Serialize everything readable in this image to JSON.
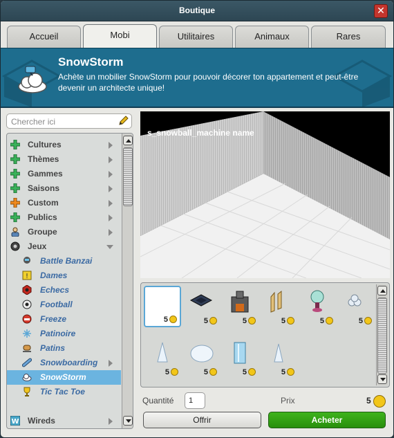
{
  "window": {
    "title": "Boutique",
    "close_glyph": "✕"
  },
  "tabs": [
    {
      "label": "Accueil"
    },
    {
      "label": "Mobi"
    },
    {
      "label": "Utilitaires"
    },
    {
      "label": "Animaux"
    },
    {
      "label": "Rares"
    }
  ],
  "banner": {
    "title": "SnowStorm",
    "text": "Achète un mobilier SnowStorm pour pouvoir décorer ton appartement et peut-être devenir un architecte unique!"
  },
  "search": {
    "placeholder": "Chercher ici"
  },
  "categories": [
    {
      "label": "Cultures",
      "icon": "green-plus-icon"
    },
    {
      "label": "Thèmes",
      "icon": "green-plus-icon"
    },
    {
      "label": "Gammes",
      "icon": "green-plus-icon"
    },
    {
      "label": "Saisons",
      "icon": "green-plus-icon"
    },
    {
      "label": "Custom",
      "icon": "orange-plus-icon"
    },
    {
      "label": "Publics",
      "icon": "green-plus-icon"
    },
    {
      "label": "Groupe",
      "icon": "group-icon"
    },
    {
      "label": "Jeux",
      "icon": "ball-icon"
    }
  ],
  "subcategories": [
    {
      "label": "Battle Banzai",
      "icon": "banzai-icon"
    },
    {
      "label": "Dames",
      "icon": "dames-icon"
    },
    {
      "label": "Echecs",
      "icon": "chess-icon"
    },
    {
      "label": "Football",
      "icon": "football-icon"
    },
    {
      "label": "Freeze",
      "icon": "freeze-icon"
    },
    {
      "label": "Patinoire",
      "icon": "snowflake-icon"
    },
    {
      "label": "Patins",
      "icon": "skates-icon"
    },
    {
      "label": "Snowboarding",
      "icon": "snowboard-icon"
    },
    {
      "label": "SnowStorm",
      "icon": "cloud-icon",
      "selected": true
    },
    {
      "label": "Tic Tac Toe",
      "icon": "trophy-icon"
    }
  ],
  "bottom_category": {
    "label": "Wireds",
    "icon": "wired-icon"
  },
  "preview": {
    "name": "s_snowball_machine name"
  },
  "products": [
    {
      "price": "5",
      "icon": "snowball-machine-icon",
      "selected": true
    },
    {
      "price": "5",
      "icon": "floor-tile-icon"
    },
    {
      "price": "5",
      "icon": "fireplace-icon"
    },
    {
      "price": "5",
      "icon": "wood-fence-icon"
    },
    {
      "price": "5",
      "icon": "snow-tree-icon"
    },
    {
      "price": "5",
      "icon": "snowball-pile-icon"
    },
    {
      "price": "5",
      "icon": "ice-spike-icon"
    },
    {
      "price": "5",
      "icon": "ice-block-icon"
    },
    {
      "price": "5",
      "icon": "ice-pillar-icon"
    },
    {
      "price": "5",
      "icon": "small-ice-spike-icon"
    }
  ],
  "purchase": {
    "quantity_label": "Quantité",
    "quantity_value": "1",
    "price_label": "Prix",
    "price_value": "5",
    "gift_button": "Offrir",
    "buy_button": "Acheter"
  },
  "colors": {
    "banner": "#1e6d8e",
    "selected": "#6bb4e0",
    "buy": "#2ea012"
  }
}
